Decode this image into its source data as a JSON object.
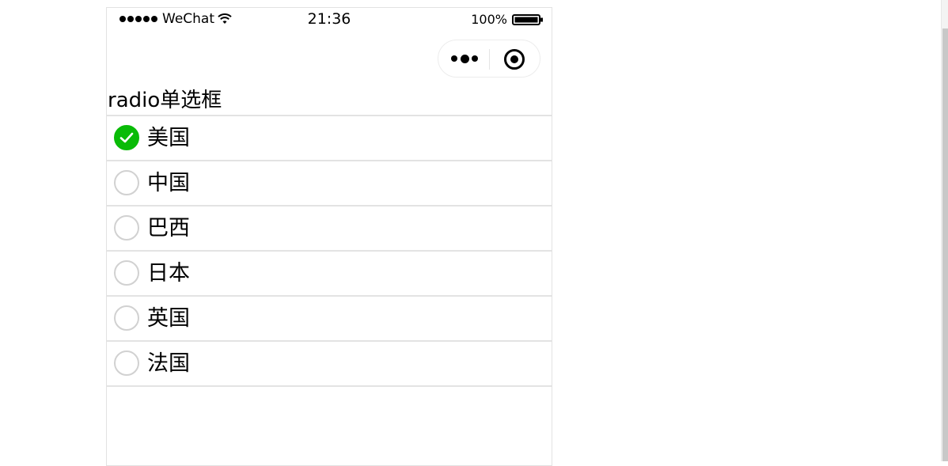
{
  "status_bar": {
    "signal_dots": 5,
    "carrier": "WeChat",
    "wifi_icon": "wifi-icon",
    "time": "21:36",
    "battery_text": "100%",
    "battery_icon": "battery-icon"
  },
  "capsule": {
    "more_icon": "more-dots-icon",
    "close_icon": "target-close-icon"
  },
  "page": {
    "title": "radio单选框"
  },
  "radio_group": {
    "selected_index": 0,
    "accent_color": "#09bb07",
    "items": [
      {
        "label": "美国",
        "checked": true
      },
      {
        "label": "中国",
        "checked": false
      },
      {
        "label": "巴西",
        "checked": false
      },
      {
        "label": "日本",
        "checked": false
      },
      {
        "label": "英国",
        "checked": false
      },
      {
        "label": "法国",
        "checked": false
      }
    ]
  }
}
